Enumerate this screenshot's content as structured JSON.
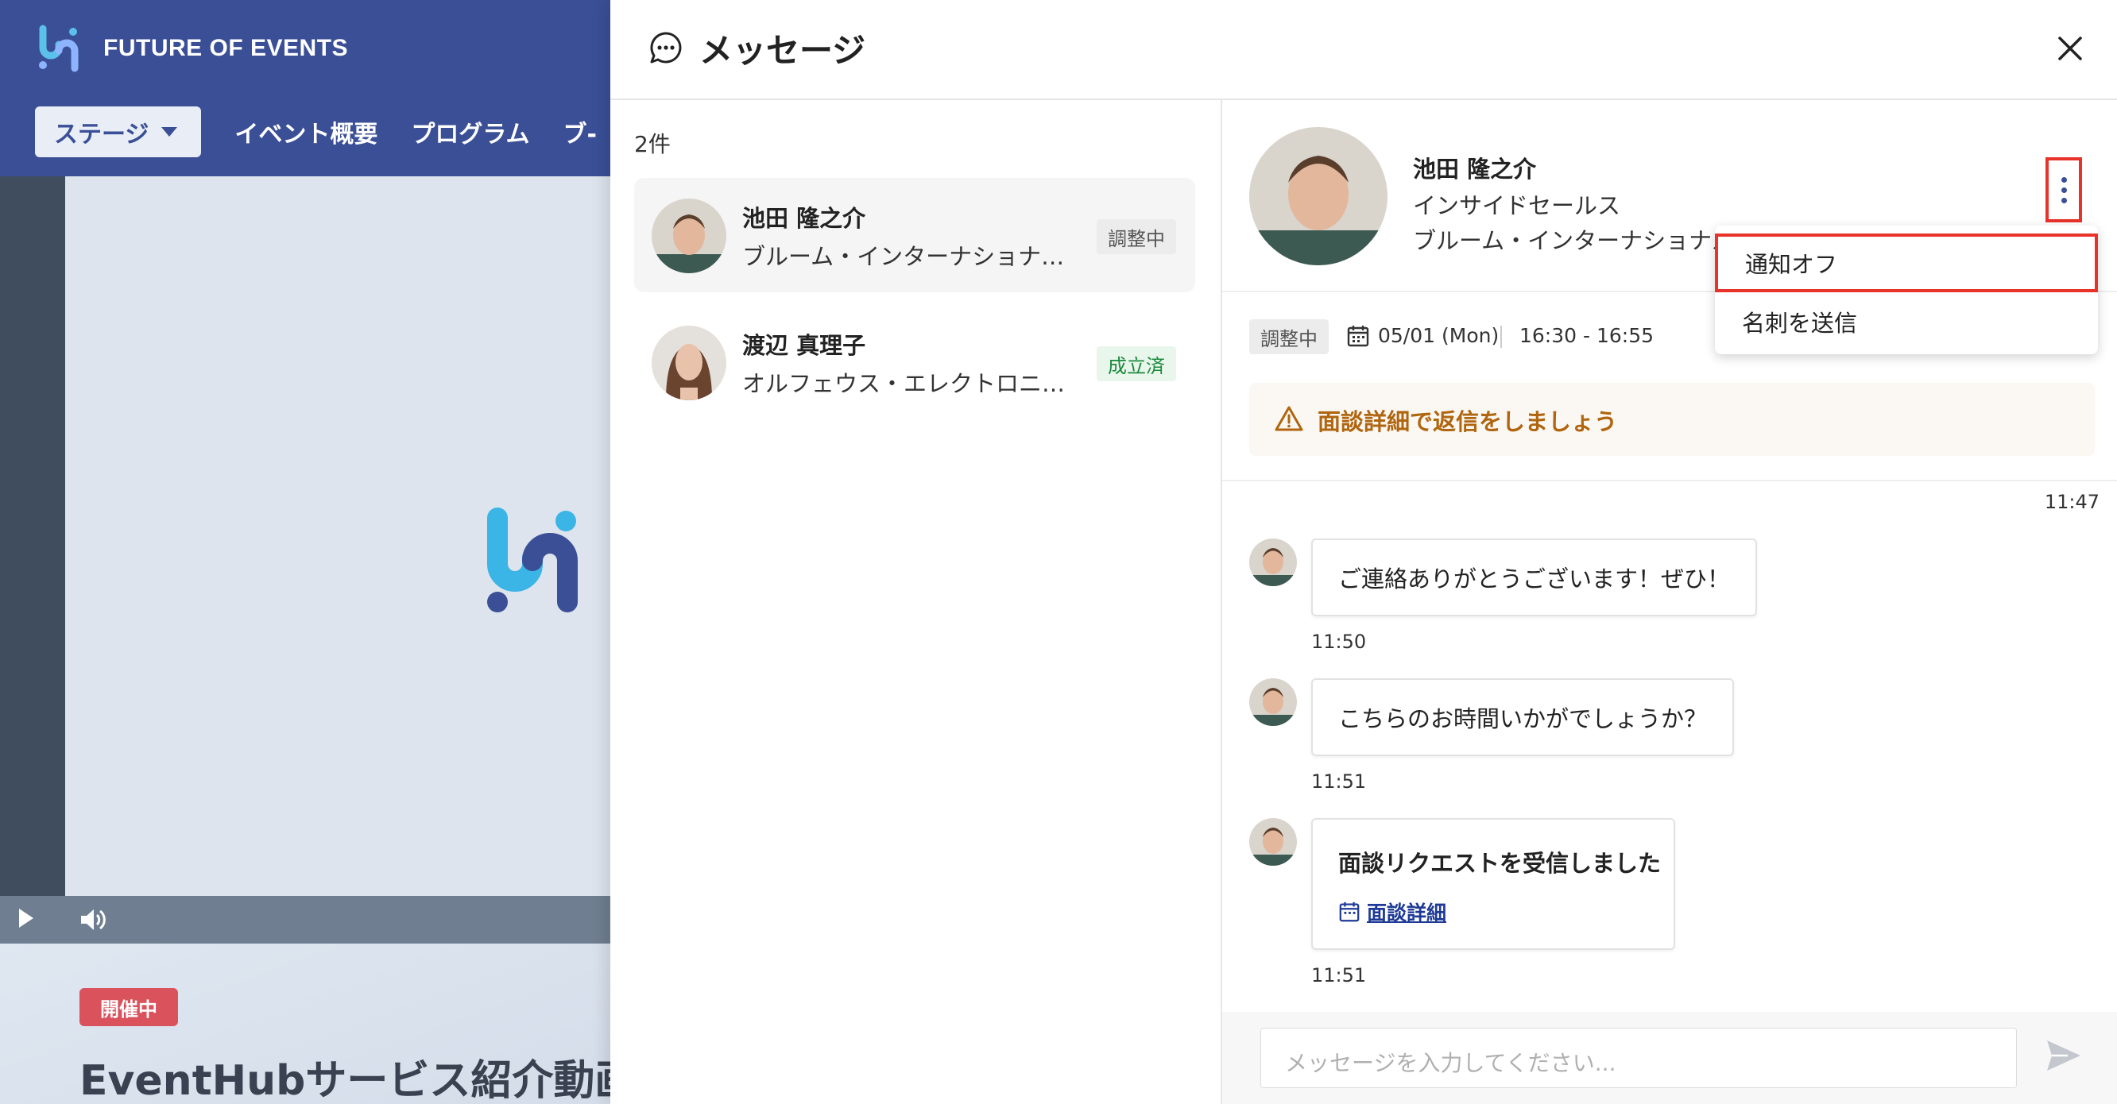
{
  "background": {
    "brand_name": "FUTURE OF EVENTS",
    "nav": {
      "stage": "ステージ",
      "overview": "イベント概要",
      "program": "プログラム",
      "booth": "ブ-"
    },
    "live_badge": "開催中",
    "video_title": "EventHubサービス紹介動画"
  },
  "drawer": {
    "title": "メッセージ",
    "count": "2件",
    "conversations": [
      {
        "name": "池田 隆之介",
        "company": "ブルーム・インターナショナル…",
        "status": "調整中"
      },
      {
        "name": "渡辺 真理子",
        "company": "オルフェウス・エレクトロニク…",
        "status": "成立済"
      }
    ],
    "contact": {
      "name": "池田 隆之介",
      "title": "インサイドセールス",
      "company": "ブルーム・インターナショナル"
    },
    "menu": {
      "notify_off": "通知オフ",
      "send_card": "名刺を送信"
    },
    "meeting": {
      "status": "調整中",
      "date": "05/01 (Mon)",
      "time": "16:30 - 16:55"
    },
    "alert": "面談詳細で返信をしましょう",
    "first_time": "11:47",
    "messages": [
      {
        "text": "ご連絡ありがとうございます！ぜひ！",
        "time": "11:50"
      },
      {
        "text": "こちらのお時間いかがでしょうか？",
        "time": "11:51"
      },
      {
        "title": "面談リクエストを受信しました",
        "link": "面談詳細",
        "time": "11:51"
      }
    ],
    "composer_placeholder": "メッセージを入力してください..."
  },
  "colors": {
    "brand": "#3a4f96",
    "highlight": "#e8322a",
    "warning": "#b0650f",
    "success": "#1b8a3a"
  },
  "icons": [
    "chat-bubble-icon",
    "close-icon",
    "more-vertical-icon",
    "calendar-icon",
    "warning-icon",
    "send-icon",
    "play-icon",
    "volume-icon"
  ]
}
